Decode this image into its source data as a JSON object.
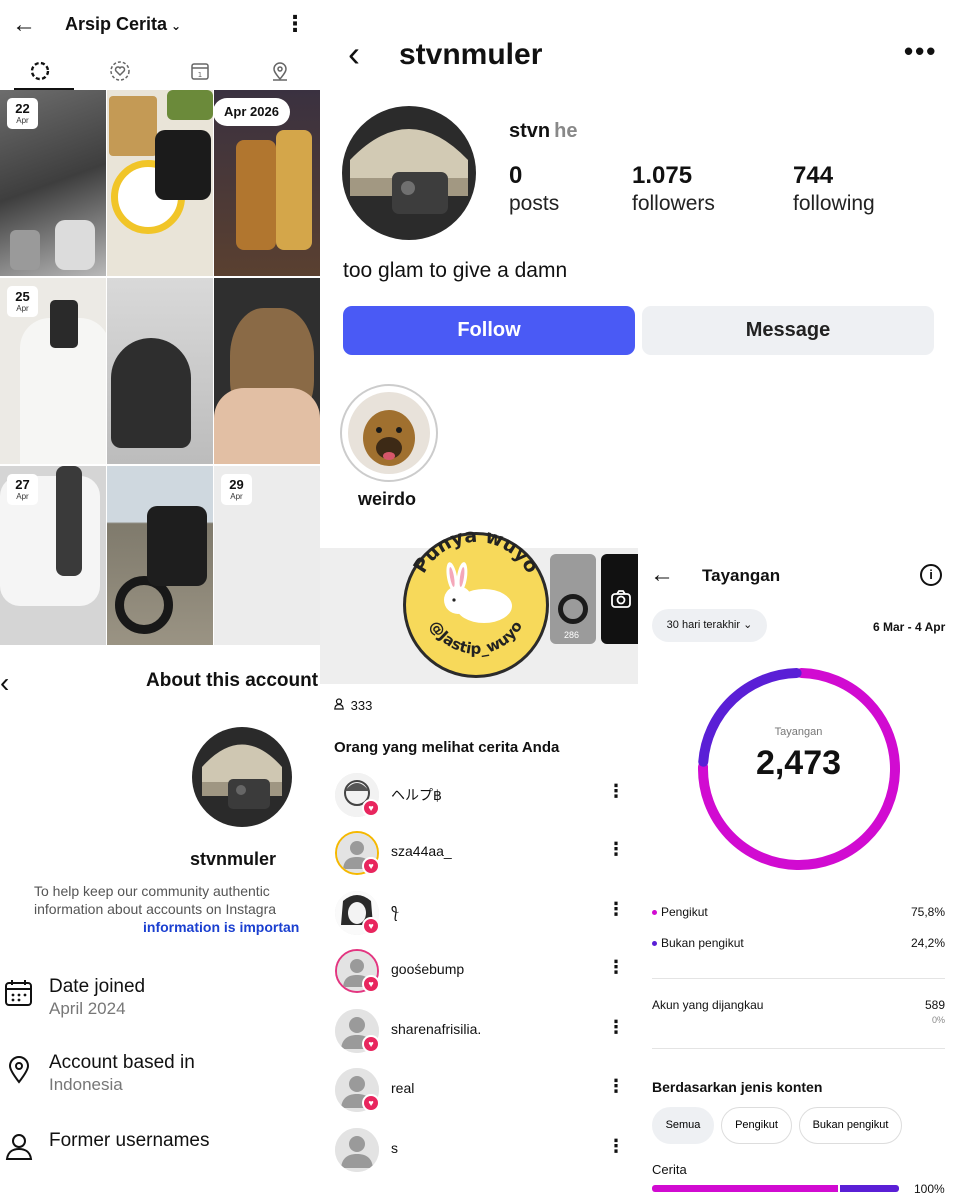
{
  "archive": {
    "title": "Arsip Cerita",
    "tabs": [
      "archive",
      "highlights",
      "calendar",
      "location"
    ],
    "month_pill": "Apr 2026",
    "cells": [
      {
        "day": "22",
        "month": "Apr"
      },
      {
        "day": "25",
        "month": "Apr"
      },
      {
        "day": "27",
        "month": "Apr"
      },
      {
        "day": "29",
        "month": "Apr"
      }
    ]
  },
  "about": {
    "title": "About this account",
    "username": "stvnmuler",
    "note_line1": "To help keep our community authentic",
    "note_line2": "information about accounts on Instagra",
    "note_link": "information is importan",
    "rows": [
      {
        "label": "Date joined",
        "value": "April 2024",
        "icon": "calendar-icon"
      },
      {
        "label": "Account based in",
        "value": "Indonesia",
        "icon": "location-pin-icon"
      },
      {
        "label": "Former usernames",
        "value": "",
        "icon": "person-icon"
      }
    ]
  },
  "profile": {
    "handle": "stvnmuler",
    "name": "stvn",
    "pronouns": "he",
    "posts": "0",
    "posts_label": "posts",
    "followers": "1.075",
    "followers_label": "followers",
    "following": "744",
    "following_label": "following",
    "bio": "too glam to give a damn",
    "follow_label": "Follow",
    "message_label": "Message",
    "highlight_label": "weirdo",
    "accent": "#4a5af5"
  },
  "viewers": {
    "count": "333",
    "title": "Orang yang melihat cerita Anda",
    "strip_views": "286",
    "list": [
      {
        "name": "ヘルプ฿"
      },
      {
        "name": "sza44aa_"
      },
      {
        "name": "ꪻ"
      },
      {
        "name": "goośebump"
      },
      {
        "name": "sharenafrisilia."
      },
      {
        "name": "real"
      },
      {
        "name": "s"
      }
    ]
  },
  "insights": {
    "title": "Tayangan",
    "range": "30 hari terakhir",
    "dates": "6 Mar - 4 Apr",
    "donut_label": "Tayangan",
    "total": "2,473",
    "followers_label": "Pengikut",
    "followers_pct": "75,8%",
    "followers_share": 0.758,
    "nonfollowers_label": "Bukan pengikut",
    "nonfollowers_pct": "24,2%",
    "nonfollowers_share": 0.242,
    "reach_label": "Akun yang dijangkau",
    "reach_value": "589",
    "reach_change": "0%",
    "section_title": "Berdasarkan jenis konten",
    "chips": [
      "Semua",
      "Pengikut",
      "Bukan pengikut"
    ],
    "content_label": "Cerita",
    "content_pct": "100%",
    "color_followers": "#d10bd1",
    "color_nonfollowers": "#5a1fd6"
  },
  "sticker": {
    "line1": "Punya wuyo",
    "line2": "@Jastip_wuyo"
  }
}
